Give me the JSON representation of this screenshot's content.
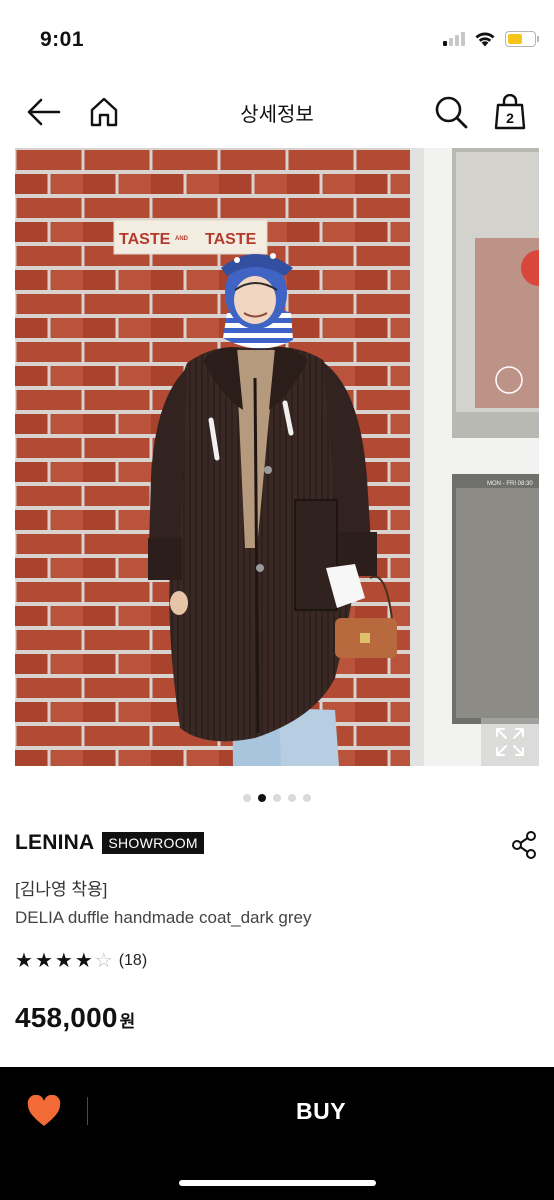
{
  "status_bar": {
    "time": "9:01",
    "icons": [
      "signal-icon",
      "wifi-icon",
      "battery-icon"
    ],
    "battery_color": "#f5c518"
  },
  "nav": {
    "title": "상세정보",
    "cart_count": "2",
    "icons": [
      "back-arrow-icon",
      "home-icon",
      "search-icon",
      "shopping-bag-icon"
    ]
  },
  "image": {
    "sign_text": "TASTE AND TASTE",
    "sign_parts": [
      "TASTE",
      "AND",
      "TASTE"
    ],
    "door_text": "MON - FRI 08:30",
    "page_count": 5,
    "active_page": 2
  },
  "product": {
    "brand": "LENINA",
    "badge": "SHOWROOM",
    "subtitle": "[김나영 착용]",
    "name": "DELIA duffle handmade coat_dark grey",
    "rating": 4,
    "rating_max": 5,
    "review_count": "(18)",
    "price": "458,000",
    "currency": "원"
  },
  "bottom_bar": {
    "buy_label": "BUY",
    "wish_color": "#f26a35"
  }
}
